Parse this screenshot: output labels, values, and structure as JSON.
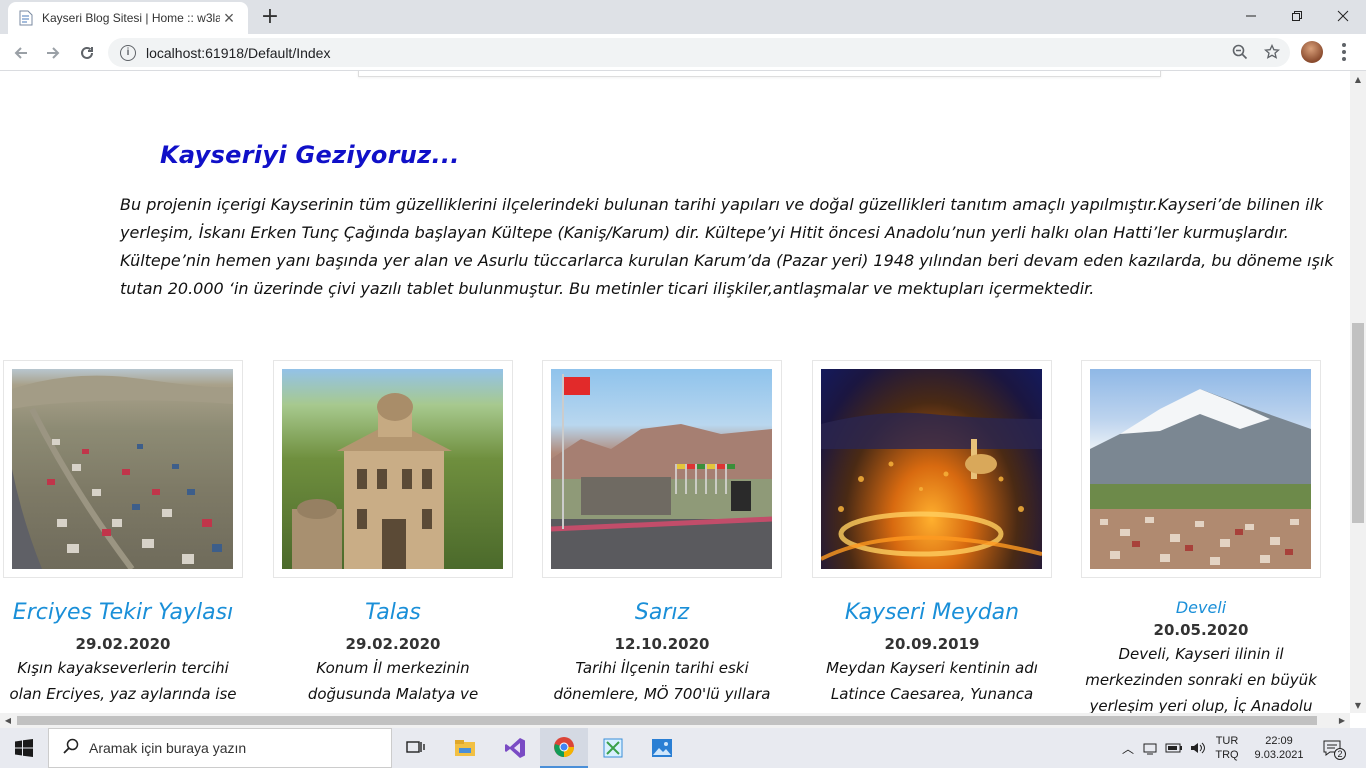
{
  "browser": {
    "tab_title": "Kayseri Blog Sitesi | Home :: w3la",
    "url": "localhost:61918/Default/Index"
  },
  "page": {
    "section_title": "Kayseriyi Geziyoruz...",
    "intro": "Bu projenin içerigi Kayserinin tüm güzelliklerini ilçelerindeki bulunan tarihi yapıları ve doğal güzellikleri tanıtım amaçlı yapılmıştır.Kayseri’de bilinen ilk yerleşim, İskanı Erken Tunç Çağında başlayan Kültepe (Kaniş/Karum) dir. Kültepe’yi Hitit öncesi Anadolu’nun yerli halkı olan Hatti’ler kurmuşlardır. Kültepe’nin hemen yanı başında yer alan ve Asurlu tüccarlarca kurulan Karum’da (Pazar yeri) 1948 yılından beri devam eden kazılarda, bu döneme ışık tutan 20.000 ‘in üzerinde çivi yazılı tablet bulunmuştur. Bu metinler ticari ilişkiler,antlaşmalar ve mektupları içermektedir.",
    "cards": [
      {
        "title": "Erciyes Tekir Yaylası",
        "date": "29.02.2020",
        "text": "Kışın kayakseverlerin tercihi olan Erciyes, yaz aylarında ise",
        "image": "erciyes-photo"
      },
      {
        "title": "Talas",
        "date": "29.02.2020",
        "text": "Konum İl merkezinin doğusunda Malatya ve",
        "image": "talas-photo"
      },
      {
        "title": "Sarız",
        "date": "12.10.2020",
        "text": "Tarihi İlçenin tarihi eski dönemlere, MÖ 700'lü yıllara",
        "image": "sariz-photo"
      },
      {
        "title": "Kayseri Meydan",
        "date": "20.09.2019",
        "text": "Meydan Kayseri kentinin adı Latince Caesarea, Yunanca",
        "image": "meydan-photo"
      },
      {
        "title": "Develi",
        "date": "20.05.2020",
        "text": "Develi, Kayseri ilinin il merkezinden sonraki en büyük yerleşim yeri olup, İç Anadolu",
        "image": "develi-photo"
      }
    ]
  },
  "taskbar": {
    "search_placeholder": "Aramak için buraya yazın",
    "lang_top": "TUR",
    "lang_bottom": "TRQ",
    "time": "22:09",
    "date": "9.03.2021",
    "notifications": "2"
  }
}
